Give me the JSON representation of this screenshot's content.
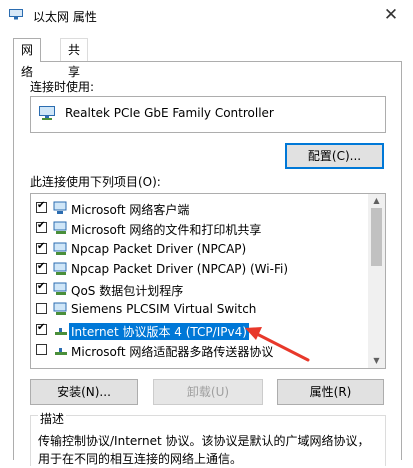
{
  "window": {
    "title": "以太网 属性",
    "close_glyph": "✕"
  },
  "tabs": [
    {
      "label": "网络",
      "active": true
    },
    {
      "label": "共享",
      "active": false
    }
  ],
  "connect_using": {
    "label": "连接时使用:",
    "adapter": "Realtek PCIe GbE Family Controller",
    "configure_button": "配置(C)..."
  },
  "items_label": "此连接使用下列项目(O):",
  "items": [
    {
      "label": "Microsoft 网络客户端",
      "checked": true,
      "icon": "network-client-icon"
    },
    {
      "label": "Microsoft 网络的文件和打印机共享",
      "checked": true,
      "icon": "network-service-icon"
    },
    {
      "label": "Npcap Packet Driver (NPCAP)",
      "checked": true,
      "icon": "network-service-icon"
    },
    {
      "label": "Npcap Packet Driver (NPCAP) (Wi-Fi)",
      "checked": true,
      "icon": "network-service-icon"
    },
    {
      "label": "QoS 数据包计划程序",
      "checked": true,
      "icon": "network-service-icon"
    },
    {
      "label": "Siemens PLCSIM Virtual Switch",
      "checked": false,
      "icon": "network-service-icon"
    },
    {
      "label": "Internet 协议版本 4 (TCP/IPv4)",
      "checked": true,
      "selected": true,
      "icon": "protocol-icon"
    },
    {
      "label": "Microsoft 网络适配器多路传送器协议",
      "checked": false,
      "icon": "protocol-icon"
    }
  ],
  "buttons": {
    "install": "安装(N)...",
    "uninstall": "卸载(U)",
    "properties": "属性(R)"
  },
  "description": {
    "legend": "描述",
    "text": "传输控制协议/Internet 协议。该协议是默认的广域网络协议，用于在不同的相互连接的网络上通信。"
  },
  "colors": {
    "selection": "#0078d7",
    "annotation_arrow": "#e8382a"
  }
}
